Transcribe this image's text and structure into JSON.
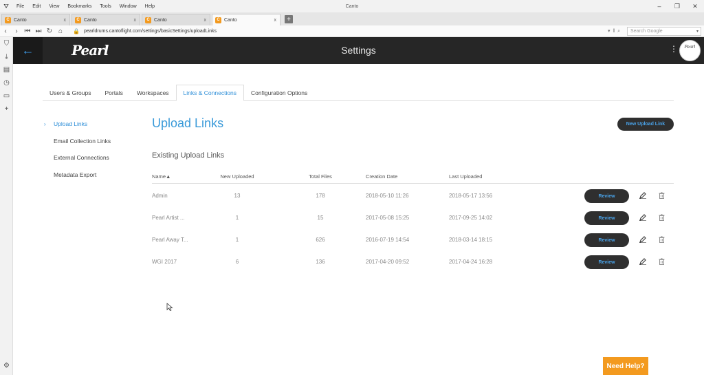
{
  "browser": {
    "menu": [
      "File",
      "Edit",
      "View",
      "Bookmarks",
      "Tools",
      "Window",
      "Help"
    ],
    "window_title": "Canto",
    "tabs": [
      {
        "label": "Canto",
        "fav": "C",
        "close": "x"
      },
      {
        "label": "Canto",
        "fav": "C",
        "close": "x"
      },
      {
        "label": "Canto",
        "fav": "C",
        "close": "x"
      },
      {
        "label": "Canto",
        "fav": "C",
        "close": "x"
      }
    ],
    "newtab_glyph": "+",
    "url": "pearldrums.cantoflight.com/settings/basicSettings/uploadLinks",
    "search_placeholder": "Search Google"
  },
  "header": {
    "logo": "Pearl",
    "title": "Settings",
    "avatar_logo": "Pearl"
  },
  "settings_tabs": [
    {
      "label": "Users & Groups"
    },
    {
      "label": "Portals"
    },
    {
      "label": "Workspaces"
    },
    {
      "label": "Links & Connections"
    },
    {
      "label": "Configuration Options"
    }
  ],
  "left_nav": [
    {
      "label": "Upload Links"
    },
    {
      "label": "Email Collection Links"
    },
    {
      "label": "External Connections"
    },
    {
      "label": "Metadata Export"
    }
  ],
  "main": {
    "title": "Upload Links",
    "new_button": "New Upload Link",
    "section_title": "Existing Upload Links",
    "columns": {
      "name": "Name▲",
      "new_uploaded": "New Uploaded",
      "total_files": "Total Files",
      "creation_date": "Creation Date",
      "last_uploaded": "Last Uploaded"
    },
    "review_label": "Review",
    "rows": [
      {
        "name": "Admin",
        "new_uploaded": "13",
        "total_files": "178",
        "creation_date": "2018-05-10 11:26",
        "last_uploaded": "2018-05-17 13:56"
      },
      {
        "name": "Pearl Artist ...",
        "new_uploaded": "1",
        "total_files": "15",
        "creation_date": "2017-05-08 15:25",
        "last_uploaded": "2017-09-25 14:02"
      },
      {
        "name": "Pearl Away T...",
        "new_uploaded": "1",
        "total_files": "626",
        "creation_date": "2016-07-19 14:54",
        "last_uploaded": "2018-03-14 18:15"
      },
      {
        "name": "WGI 2017",
        "new_uploaded": "6",
        "total_files": "136",
        "creation_date": "2017-04-20 09:52",
        "last_uploaded": "2017-04-24 16:28"
      }
    ]
  },
  "help": {
    "label": "Need Help?"
  },
  "colors": {
    "accent": "#3a9ad9",
    "header_bg": "#262626",
    "button_bg": "#2f2f2f",
    "help_bg": "#f39a1f"
  }
}
